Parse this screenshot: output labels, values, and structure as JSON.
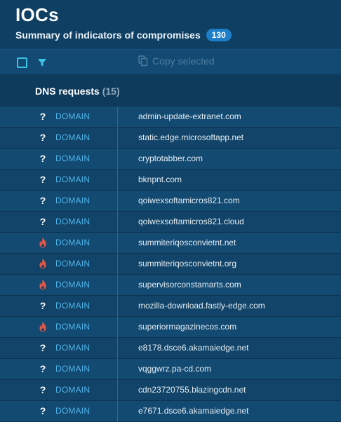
{
  "header": {
    "title": "IOCs",
    "subtitle": "Summary of indicators of compromises",
    "badge": "130"
  },
  "toolbar": {
    "copy_label": "Copy selected",
    "icons": [
      "checkbox",
      "filter-icon",
      "copy-icon"
    ]
  },
  "section": {
    "title": "DNS requests",
    "count": "(15)"
  },
  "colors": {
    "accent": "#3cc3e8",
    "type_text": "#4fb3e8",
    "danger": "#e05a4b",
    "background": "#0e3a5c"
  },
  "rows": [
    {
      "status": "unknown",
      "icon": "?",
      "type": "DOMAIN",
      "value": "admin-update-extranet.com"
    },
    {
      "status": "unknown",
      "icon": "?",
      "type": "DOMAIN",
      "value": "static.edge.microsoftapp.net"
    },
    {
      "status": "unknown",
      "icon": "?",
      "type": "DOMAIN",
      "value": "cryptotabber.com"
    },
    {
      "status": "unknown",
      "icon": "?",
      "type": "DOMAIN",
      "value": "bknpnt.com"
    },
    {
      "status": "unknown",
      "icon": "?",
      "type": "DOMAIN",
      "value": "qoiwexsoftamicros821.com"
    },
    {
      "status": "unknown",
      "icon": "?",
      "type": "DOMAIN",
      "value": "qoiwexsoftamicros821.cloud"
    },
    {
      "status": "malicious",
      "icon": "fire",
      "type": "DOMAIN",
      "value": "summiteriqosconvietnt.net"
    },
    {
      "status": "malicious",
      "icon": "fire",
      "type": "DOMAIN",
      "value": "summiteriqosconvietnt.org"
    },
    {
      "status": "malicious",
      "icon": "fire",
      "type": "DOMAIN",
      "value": "supervisorconstamarts.com"
    },
    {
      "status": "unknown",
      "icon": "?",
      "type": "DOMAIN",
      "value": "mozilla-download.fastly-edge.com"
    },
    {
      "status": "malicious",
      "icon": "fire",
      "type": "DOMAIN",
      "value": "superiormagazinecos.com"
    },
    {
      "status": "unknown",
      "icon": "?",
      "type": "DOMAIN",
      "value": "e8178.dsce6.akamaiedge.net"
    },
    {
      "status": "unknown",
      "icon": "?",
      "type": "DOMAIN",
      "value": "vqggwrz.pa-cd.com"
    },
    {
      "status": "unknown",
      "icon": "?",
      "type": "DOMAIN",
      "value": "cdn23720755.blazingcdn.net"
    },
    {
      "status": "unknown",
      "icon": "?",
      "type": "DOMAIN",
      "value": "e7671.dsce6.akamaiedge.net"
    }
  ]
}
